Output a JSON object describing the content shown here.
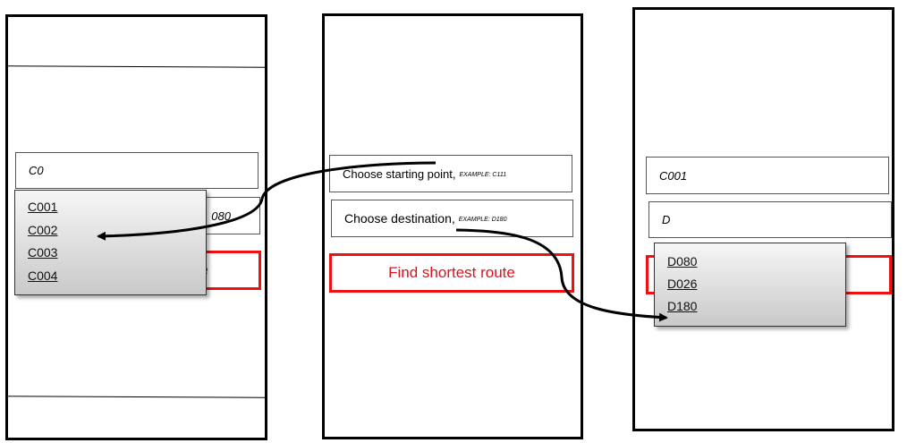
{
  "left_screen": {
    "start_value": "C0",
    "dest_partial": "080",
    "route_partial": "e",
    "dropdown_items": [
      "C001",
      "C002",
      "C003",
      "C004"
    ]
  },
  "middle_screen": {
    "start_placeholder": "Choose starting point,",
    "start_example": "EXAMPLE: C111",
    "dest_placeholder": "Choose destination,",
    "dest_example": "EXAMPLE: D180",
    "route_button": "Find shortest route"
  },
  "right_screen": {
    "start_value": "C001",
    "dest_value": "D",
    "dropdown_items": [
      "D080",
      "D026",
      "D180"
    ]
  },
  "colors": {
    "accent_red": "#ee1111",
    "button_text": "#e0101a",
    "frame": "#000000"
  }
}
